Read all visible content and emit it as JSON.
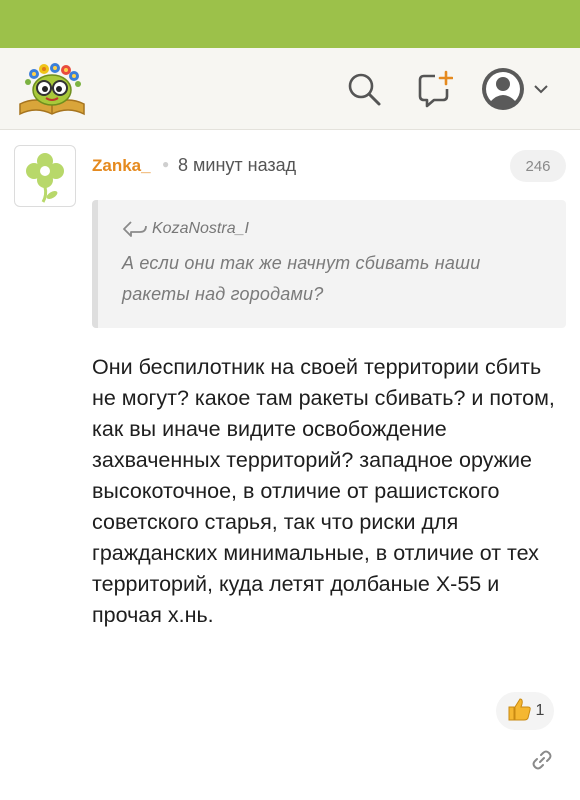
{
  "comment": {
    "author": "Zanka_",
    "time": "8 минут назад",
    "count": "246",
    "quote": {
      "author": "KozaNostra_I",
      "text": "А если они так же начнут сбивать наши ракеты над городами?"
    },
    "text": "Они беспилотник на своей территории сбить не могут? какое там ракеты сбивать? и потом, как вы иначе видите освобождение захваченных территорий? западное оружие высокоточное, в отличие от рашистского советского старья, так что риски для гражданских минимальные, в отличие от тех территорий, куда летят долбаные Х-55 и прочая х.нь.",
    "likes": "1"
  },
  "colors": {
    "top_bar": "#9cc14a",
    "author": "#e58a1f",
    "header_bg": "#f7f6f2"
  },
  "icons": {
    "search": "search-icon",
    "compose": "compose-icon",
    "profile": "user-avatar-icon",
    "chevron": "chevron-down-icon",
    "reply": "reply-arrow-icon",
    "like": "thumbs-up-icon",
    "link": "link-icon"
  }
}
